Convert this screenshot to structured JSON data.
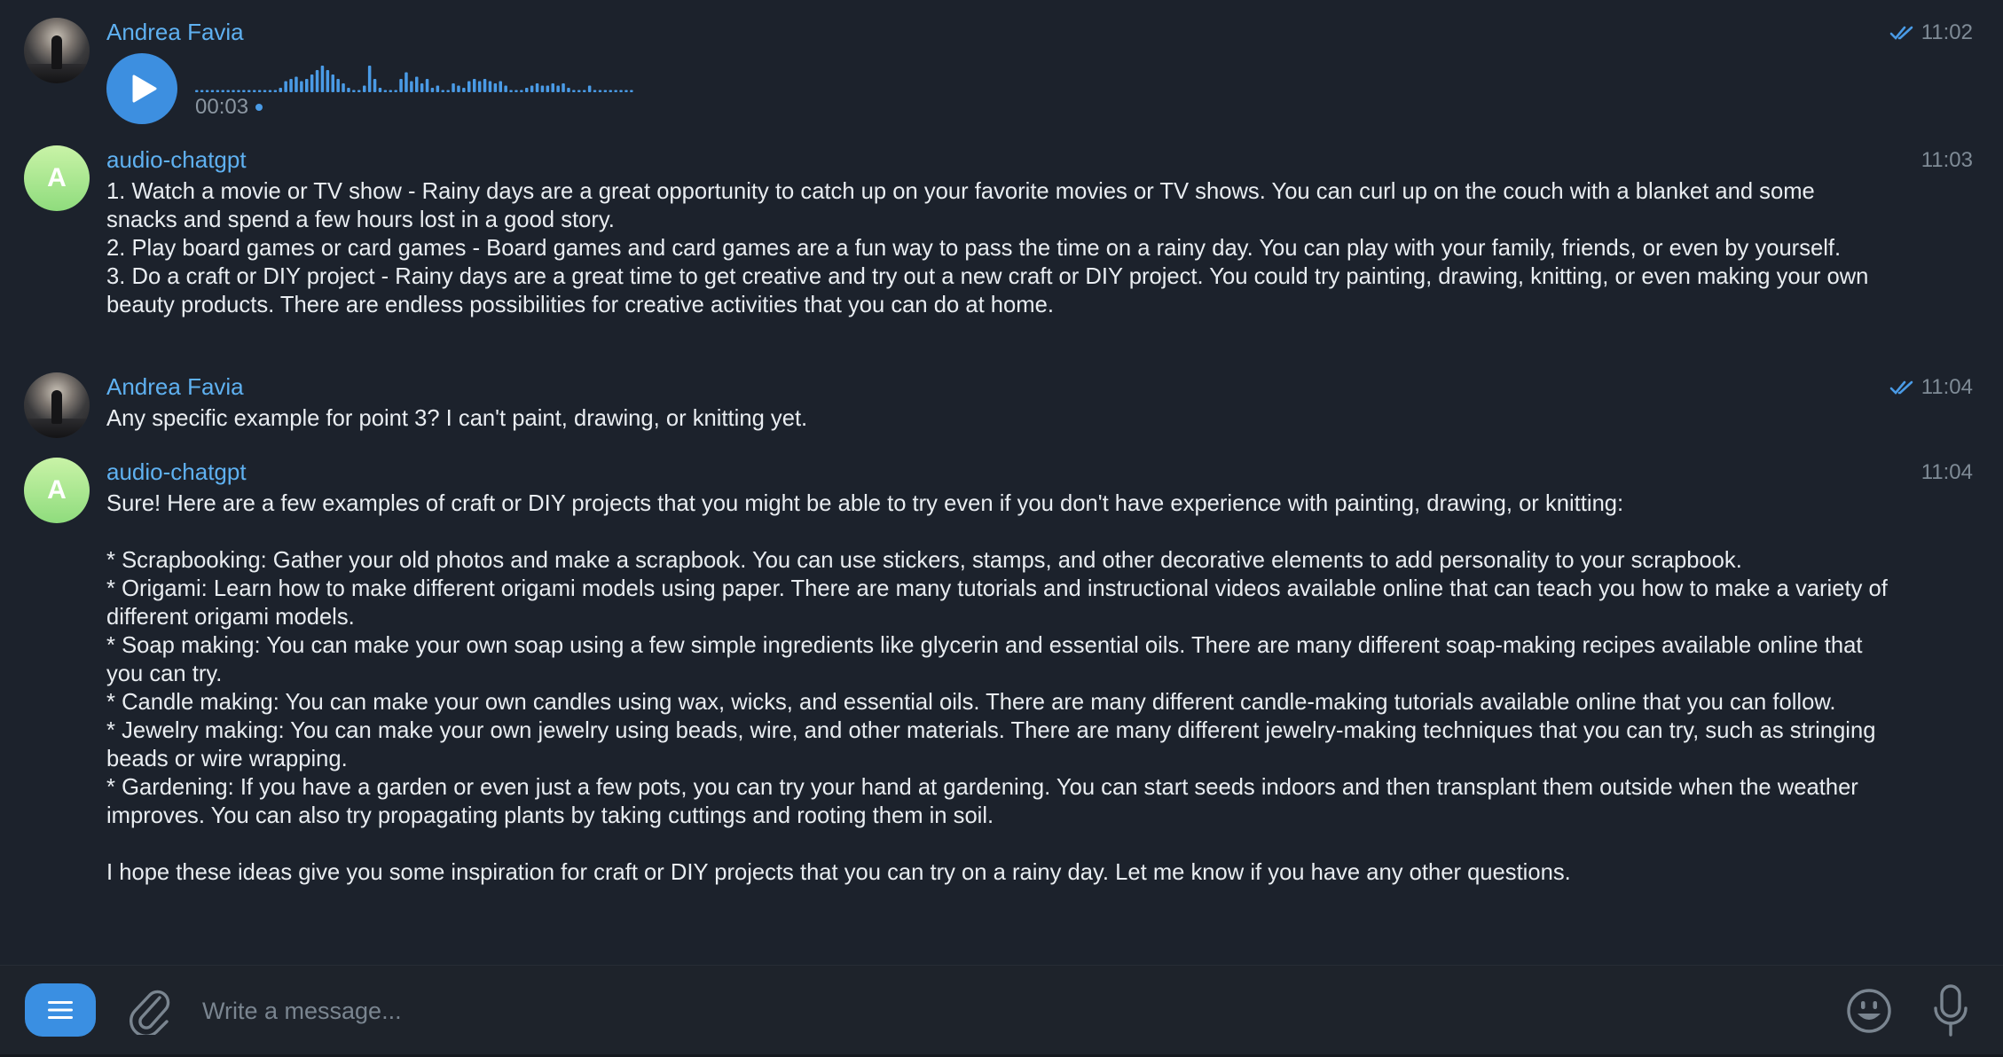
{
  "messages": [
    {
      "sender": "Andrea Favia",
      "time": "11:02",
      "read": true,
      "type": "voice",
      "duration": "00:03"
    },
    {
      "sender": "audio-chatgpt",
      "avatar_letter": "A",
      "time": "11:03",
      "text": "1. Watch a movie or TV show - Rainy days are a great opportunity to catch up on your favorite movies or TV shows. You can curl up on the couch with a blanket and some snacks and spend a few hours lost in a good story.\n2. Play board games or card games - Board games and card games are a fun way to pass the time on a rainy day. You can play with your family, friends, or even by yourself.\n3. Do a craft or DIY project - Rainy days are a great time to get creative and try out a new craft or DIY project. You could try painting, drawing, knitting, or even making your own beauty products. There are endless possibilities for creative activities that you can do at home."
    },
    {
      "sender": "Andrea Favia",
      "time": "11:04",
      "read": true,
      "text": "Any specific example for point 3? I can't paint, drawing, or knitting yet."
    },
    {
      "sender": "audio-chatgpt",
      "avatar_letter": "A",
      "time": "11:04",
      "text": "Sure! Here are a few examples of craft or DIY projects that you might be able to try even if you don't have experience with painting, drawing, or knitting:\n\n* Scrapbooking: Gather your old photos and make a scrapbook. You can use stickers, stamps, and other decorative elements to add personality to your scrapbook.\n* Origami: Learn how to make different origami models using paper. There are many tutorials and instructional videos available online that can teach you how to make a variety of different origami models.\n* Soap making: You can make your own soap using a few simple ingredients like glycerin and essential oils. There are many different soap-making recipes available online that you can try.\n* Candle making: You can make your own candles using wax, wicks, and essential oils. There are many different candle-making tutorials available online that you can follow.\n* Jewelry making: You can make your own jewelry using beads, wire, and other materials. There are many different jewelry-making techniques that you can try, such as stringing beads or wire wrapping.\n* Gardening: If you have a garden or even just a few pots, you can try your hand at gardening. You can start seeds indoors and then transplant them outside when the weather improves. You can also try propagating plants by taking cuttings and rooting them in soil.\n\nI hope these ideas give you some inspiration for craft or DIY projects that you can try on a rainy day. Let me know if you have any other questions."
    }
  ],
  "composer": {
    "placeholder": "Write a message..."
  },
  "colors": {
    "background": "#1c222c",
    "accent": "#3d8fe0",
    "sender_name": "#5fb1f1",
    "timestamp": "#7f8b96"
  },
  "icons": [
    "menu-icon",
    "paperclip-icon",
    "emoji-icon",
    "microphone-icon",
    "play-icon",
    "double-check-icon"
  ]
}
